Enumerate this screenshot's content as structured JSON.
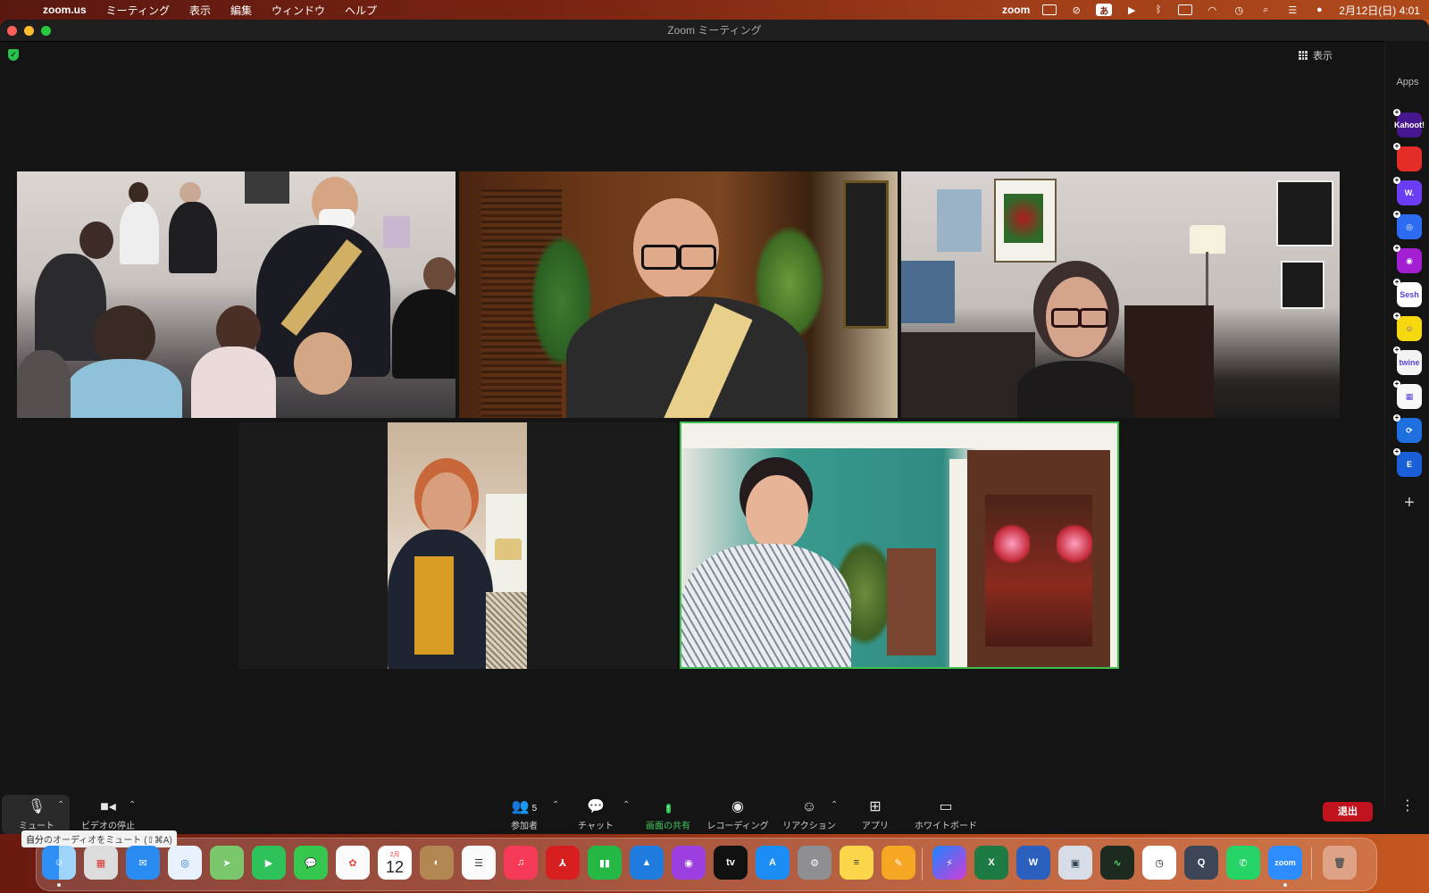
{
  "menubar": {
    "app_name": "zoom.us",
    "items": [
      "ミーティング",
      "表示",
      "編集",
      "ウィンドウ",
      "ヘルプ"
    ],
    "status_zoom": "zoom",
    "ime": "あ",
    "datetime": "2月12日(日) 4:01"
  },
  "window": {
    "title": "Zoom ミーティング",
    "view_label": "表示"
  },
  "apps": {
    "title": "Apps",
    "items": [
      {
        "name": "Kahoot!",
        "short": "Kahoot!",
        "color": "#46178f"
      },
      {
        "name": "Red app",
        "short": "",
        "color": "#e52d27"
      },
      {
        "name": "W app",
        "short": "W.",
        "color": "#6a3df2"
      },
      {
        "name": "Circle app",
        "short": "◎",
        "color": "#2d6bf2"
      },
      {
        "name": "Radio app",
        "short": "◉",
        "color": "#a11fd0"
      },
      {
        "name": "Sesh",
        "short": "Sesh",
        "color": "#ffffff"
      },
      {
        "name": "Smile app",
        "short": "☺",
        "color": "#f5d80f"
      },
      {
        "name": "twine",
        "short": "twine",
        "color": "#f3f3f3"
      },
      {
        "name": "Blocks app",
        "short": "▦",
        "color": "#f7f7f7"
      },
      {
        "name": "Sync app",
        "short": "⟳",
        "color": "#1e6fe0"
      },
      {
        "name": "E app",
        "short": "E",
        "color": "#1a5fd8"
      }
    ]
  },
  "toolbar": {
    "mute": "ミュート",
    "video": "ビデオの停止",
    "participants": "参加者",
    "participants_count": "5",
    "chat": "チャット",
    "share": "画面の共有",
    "record": "レコーディング",
    "reactions": "リアクション",
    "apps": "アプリ",
    "whiteboard": "ホワイトボード",
    "leave": "退出",
    "tooltip": "自分のオーディオをミュート (⇧⌘A)"
  },
  "dock": {
    "calendar_month": "2月",
    "calendar_day": "12",
    "tv_label": "tv",
    "zoom_label": "zoom"
  }
}
